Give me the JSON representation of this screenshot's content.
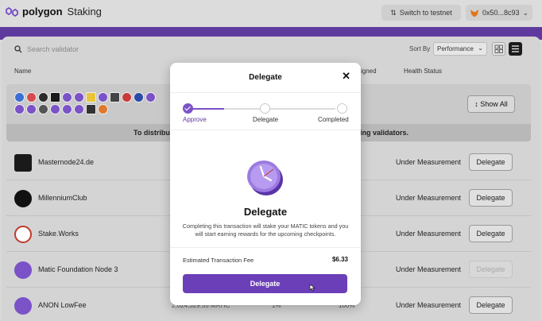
{
  "topbar": {
    "brand": "polygon",
    "product": "Staking",
    "switch_label": "Switch to testnet",
    "wallet_label": "0x50...8c93"
  },
  "toolbar": {
    "search_placeholder": "Search validator",
    "sort_by_label": "Sort By",
    "sort_value": "Performance"
  },
  "table": {
    "col_name": "Name",
    "col_assigned": "igned",
    "col_health": "Health Status"
  },
  "featured": {
    "show_all_label": "Show All",
    "banner_left": "To distribute",
    "banner_right": "ing validators."
  },
  "rows": [
    {
      "name": "Masternode24.de",
      "health": "Under Measurement",
      "action": "Delegate"
    },
    {
      "name": "MillenniumClub",
      "health": "Under Measurement",
      "action": "Delegate"
    },
    {
      "name": "Stake.Works",
      "health": "Under Measurement",
      "action": "Delegate"
    },
    {
      "name": "Matic Foundation Node 3",
      "health": "Under Measurement",
      "action": "Delegate"
    },
    {
      "name": "ANON LowFee",
      "health": "Under Measurement",
      "action": "Delegate",
      "stake": "2,024,329.55 MATIC",
      "commission": "1%",
      "uptime": "100%"
    }
  ],
  "modal": {
    "title": "Delegate",
    "steps": [
      "Approve",
      "Delegate",
      "Completed"
    ],
    "heading": "Delegate",
    "description": "Completing this transaction will stake your MATIC tokens and you will start earning rewards for the upcoming checkpoints.",
    "fee_label": "Estimated Transaction Fee",
    "fee_value": "$6.33",
    "button_label": "Delegate"
  },
  "colors": {
    "brand_purple": "#7b52c8",
    "button_purple": "#6b3fb8",
    "band_purple": "#5f3a9e"
  }
}
